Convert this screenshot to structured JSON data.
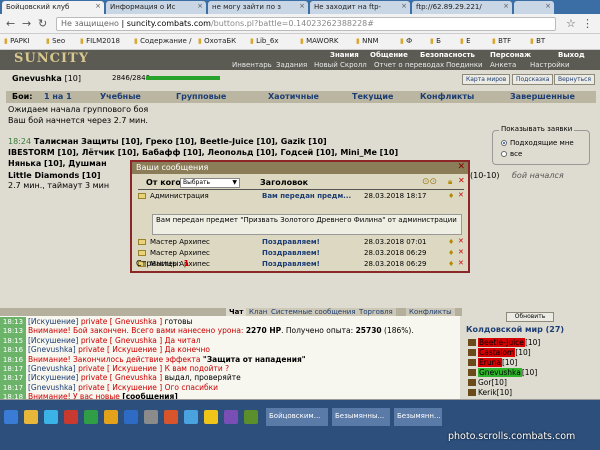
{
  "browser": {
    "tabs": [
      {
        "title": "Бойцовский клуб"
      },
      {
        "title": "Информация о Ис"
      },
      {
        "title": "не могу зайти по з"
      },
      {
        "title": "Не заходит на ftp-"
      },
      {
        "title": "ftp://62.89.29.221/"
      },
      {
        "title": ""
      }
    ],
    "address": {
      "security": "Не защищено",
      "domain": "suncity.combats.com",
      "path": "/buttons.pl?battle=0.14023262388228#"
    },
    "bookmarks": [
      "PAPKI",
      "Seo",
      "FILM2018",
      "Содержание /",
      "ОхотаБК",
      "Lib_6x",
      "MAWORK",
      "NNM",
      "Ф",
      "Б",
      "Е",
      "BTF",
      "BT"
    ]
  },
  "game": {
    "logo": "SUNCITY",
    "nav_top": [
      "Знания",
      "Общение",
      "Безопасность",
      "Персонаж",
      "Выход"
    ],
    "nav_sub": [
      "Инвентарь",
      "Задания",
      "Новый Скролл",
      "Отчет о переводах",
      "Поединки",
      "Анкета",
      "Настройки"
    ],
    "player": {
      "name": "Gnevushka",
      "level": "[10]",
      "hp": "2846/2846"
    },
    "side_buttons": [
      "Карта миров",
      "Подсказка",
      "Вернуться"
    ],
    "fight_tabs": {
      "label": "Бои:",
      "items": [
        "1 на 1",
        "Учебные",
        "Групповые",
        "Хаотичные",
        "Текущие",
        "Конфликты",
        "Завершенные"
      ]
    },
    "waiting": "Ожидаем начала группового боя",
    "starts_in": "Ваш бой начнется через 2.7 мин.",
    "show_requests": {
      "title": "Показывать заявки",
      "options": [
        "Подходящие мне",
        "все"
      ],
      "selected": 0
    },
    "team_lines": [
      {
        "time": "18:24",
        "text": "Талисман Защиты [10], Греко [10], Beetle-Juice [10], Gazik [10]"
      },
      {
        "time": "",
        "text": "IBESTORM [10], Лётчик [10], Бабафф [10], Леопольд [10], Годсей [10], Mini_Me [10]"
      },
      {
        "time": "",
        "text": "Нянька [10], Душман"
      },
      {
        "time": "",
        "text": "Little Diamonds [10]"
      }
    ],
    "team_tail": "2.7 мин., таймаут 3 мин",
    "team_tail2": "(10-10)",
    "fight_begin": "бой начался"
  },
  "messages": {
    "title": "Ваши сообщения",
    "from_label": "От кого",
    "select_value": "Выбрать",
    "subject_header": "Заголовок",
    "rows": [
      {
        "from": "Администрация",
        "subject": "Вам передан предм...",
        "date": "28.03.2018 18:17"
      },
      {
        "from": "Мастер Архипес",
        "subject": "Поздравляем!",
        "date": "28.03.2018 07:01"
      },
      {
        "from": "Мастер Архипес",
        "subject": "Поздравляем!",
        "date": "28.03.2018 06:29"
      },
      {
        "from": "Мастер Архипес",
        "subject": "Поздравляем!",
        "date": "28.03.2018 06:29"
      }
    ],
    "body": "Вам передан предмет \"Призвать Золотого Древнего Филина\" от администрации",
    "pages_label": "Страницы:",
    "page": "1"
  },
  "chat": {
    "tabs": [
      "Чат",
      "Клан",
      "Системные сообщения",
      "Торговля",
      "Конфликты"
    ],
    "lines": [
      {
        "time": "18:13",
        "parts": [
          [
            "blue",
            "[Искушение]"
          ],
          [
            "priv",
            " private [ Gnevushka ] "
          ],
          [
            "",
            "готовы"
          ]
        ]
      },
      {
        "time": "18:13",
        "parts": [
          [
            "red",
            "Внимание! Бой закончен. Всего вами нанесено урона: "
          ],
          [
            "bld",
            "2270 HP"
          ],
          [
            "",
            ". Получено опыта: "
          ],
          [
            "bld",
            "25730"
          ],
          [
            "",
            " (186%)."
          ]
        ]
      },
      {
        "time": "18:15",
        "parts": [
          [
            "blue",
            "[Искушение]"
          ],
          [
            "priv",
            " private [ Gnevushka ] "
          ],
          [
            "mag",
            "Да читал"
          ]
        ]
      },
      {
        "time": "18:16",
        "parts": [
          [
            "blue",
            "[Gnevushka]"
          ],
          [
            "priv",
            " private [ Искушение ] "
          ],
          [
            "mag",
            "Да конечно"
          ]
        ]
      },
      {
        "time": "18:16",
        "parts": [
          [
            "red",
            "Внимание! Закончилось действие эффекта "
          ],
          [
            "bld",
            "\"Защита от нападения\""
          ]
        ]
      },
      {
        "time": "18:17",
        "parts": [
          [
            "blue",
            "[Gnevushka]"
          ],
          [
            "priv",
            " private [ Искушение ] "
          ],
          [
            "mag",
            "К вам подойти ?"
          ]
        ]
      },
      {
        "time": "18:17",
        "parts": [
          [
            "blue",
            "[Искушение]"
          ],
          [
            "priv",
            " private [ Gnevushka ] "
          ],
          [
            "",
            "выдал, проверяйте"
          ]
        ]
      },
      {
        "time": "18:17",
        "parts": [
          [
            "blue",
            "[Gnevushka]"
          ],
          [
            "priv",
            " private [ Искушение ] "
          ],
          [
            "mag",
            "Ого спасибки"
          ]
        ]
      },
      {
        "time": "18:18",
        "parts": [
          [
            "red",
            "Внимание! У вас новые "
          ],
          [
            "bld",
            "[сообщения]"
          ]
        ]
      },
      {
        "time": "18:19",
        "parts": [
          [
            "blue",
            "[Искушение]"
          ],
          [
            "priv",
            " private [ Gnevushka ] "
          ],
          [
            "",
            "поздравляю."
          ]
        ]
      },
      {
        "time": "18:19",
        "parts": [
          [
            "blue",
            "[Gnevushka]"
          ],
          [
            "priv",
            " private [ Искушение ] "
          ],
          [
            "mag",
            "Большое спасибо МОЙ первый выигрыш за 10 лет :))"
          ]
        ]
      }
    ]
  },
  "online": {
    "refresh": "Обновить",
    "world": "Колдовской мир (27)",
    "players": [
      {
        "name": "Beetle-Juice",
        "level": "[10]",
        "hl": "hl"
      },
      {
        "name": "Castalom",
        "level": "[10]",
        "hl": "hl"
      },
      {
        "name": "Eruna",
        "level": "[10]",
        "hl": "hl"
      },
      {
        "name": "Gnevushka",
        "level": "[10]",
        "hl": "hlg"
      },
      {
        "name": "Gor",
        "level": "[10]",
        "hl": ""
      },
      {
        "name": "Kerik",
        "level": "[10]",
        "hl": ""
      }
    ]
  },
  "taskbar": {
    "items": [
      "Бойцовским...",
      "Безымянны...",
      "Безымянн..."
    ]
  },
  "watermark": "photo.scrolls.combats.com"
}
